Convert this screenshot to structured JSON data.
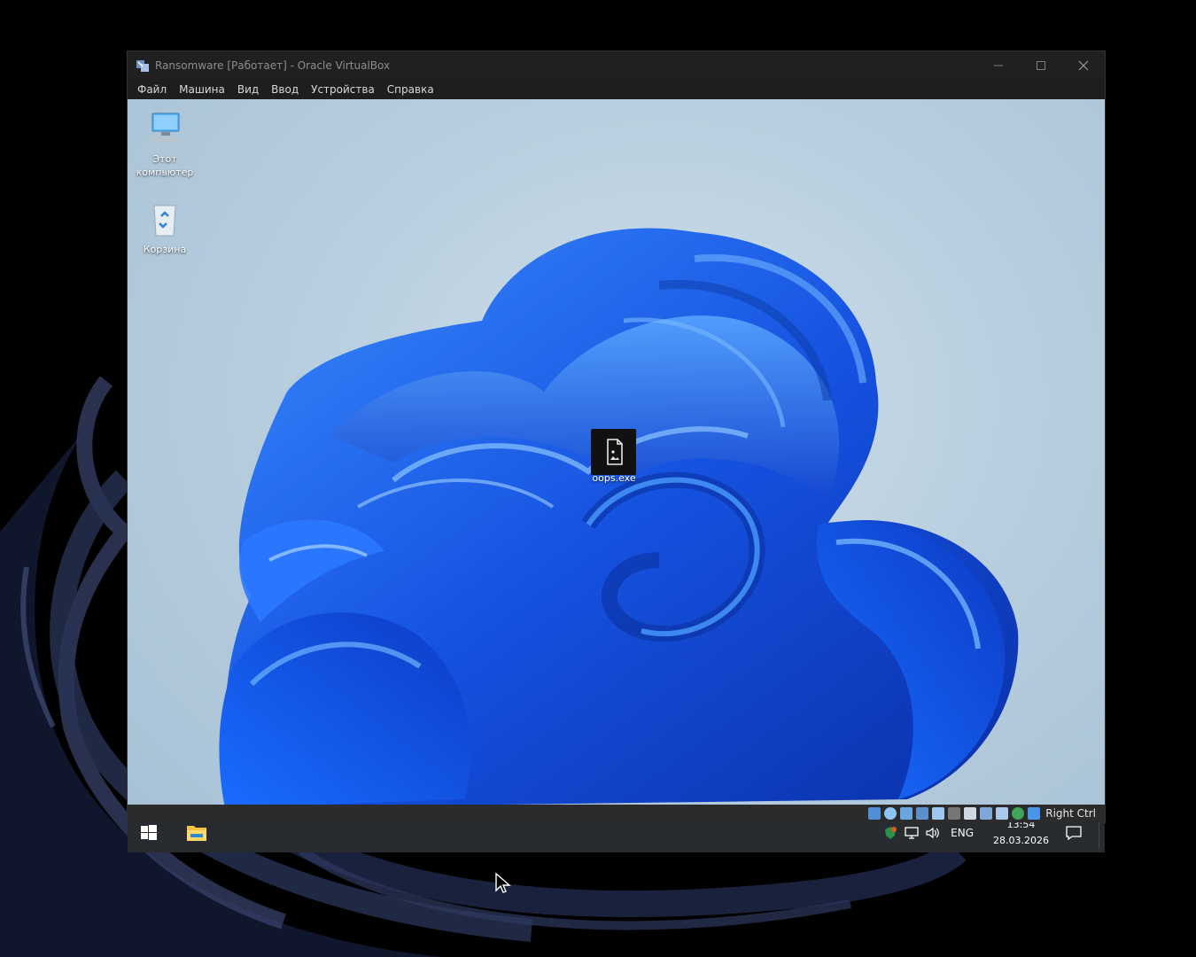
{
  "window": {
    "title": "Ransomware [Работает] - Oracle VirtualBox",
    "controls": [
      "minimize-icon",
      "maximize-icon",
      "close-icon"
    ]
  },
  "menu": {
    "items": [
      {
        "label": "Файл"
      },
      {
        "label": "Машина"
      },
      {
        "label": "Вид"
      },
      {
        "label": "Ввод"
      },
      {
        "label": "Устройства"
      },
      {
        "label": "Справка"
      }
    ]
  },
  "desktop": {
    "icons": [
      {
        "line1": "Этот",
        "line2": "компьютер",
        "icon": "computer-icon"
      },
      {
        "line1": "Корзина",
        "icon": "recycle-bin-icon"
      },
      {
        "line1": "oops.exe",
        "icon": "file-icon"
      }
    ]
  },
  "taskbar": {
    "language": "ENG",
    "time": "13:54",
    "date": "28.03.2026"
  },
  "statusbar": {
    "host_key": "Right Ctrl"
  },
  "colors": {
    "accent": "#1a5fe8",
    "titlebar": "#202020"
  }
}
